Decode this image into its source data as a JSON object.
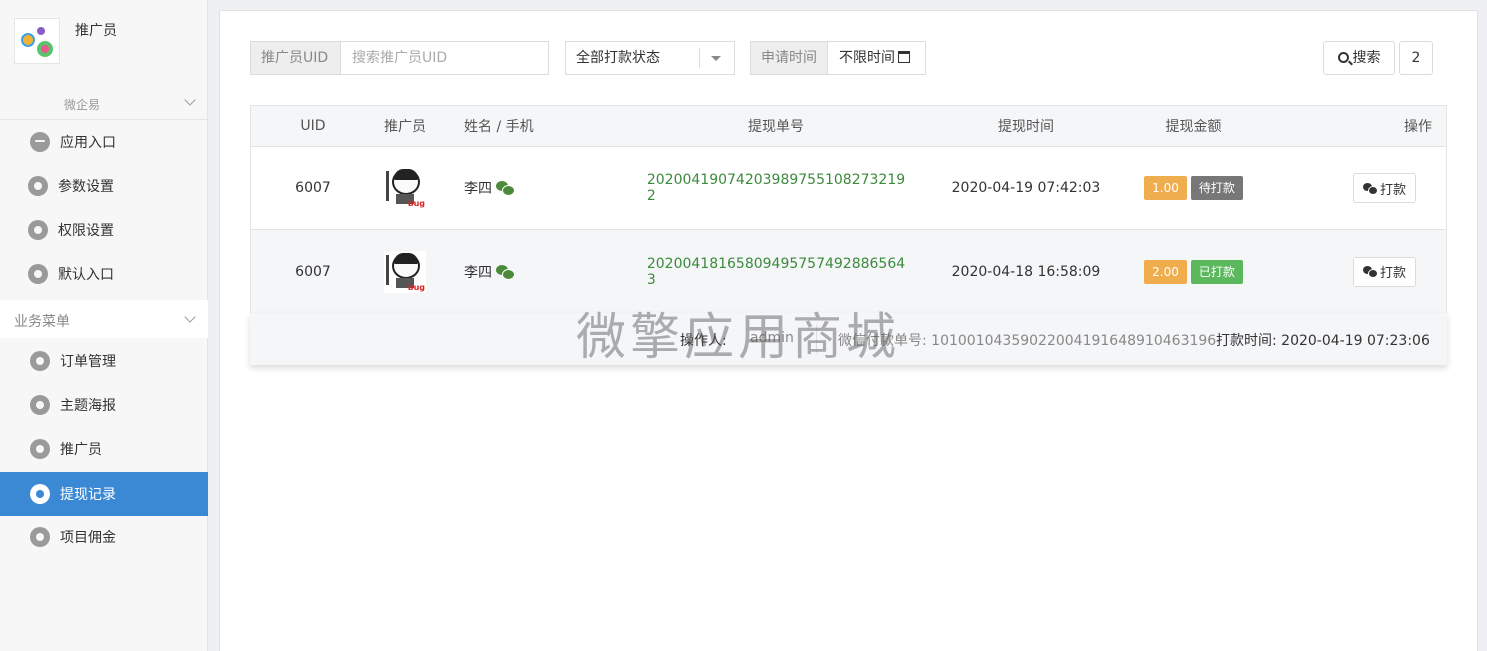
{
  "sidebar": {
    "brand_name": "推广员",
    "wx_group": "微企易",
    "top_items": [
      {
        "label": "应用入口",
        "icon": "chat-bubble-icon"
      },
      {
        "label": "参数设置",
        "icon": "gear-icon"
      },
      {
        "label": "权限设置",
        "icon": "gear-icon"
      },
      {
        "label": "默认入口",
        "icon": "gear-icon"
      }
    ],
    "business_group": "业务菜单",
    "business_items": [
      {
        "label": "订单管理",
        "icon": "gear-icon"
      },
      {
        "label": "主题海报",
        "icon": "gear-icon"
      },
      {
        "label": "推广员",
        "icon": "gear-icon"
      },
      {
        "label": "提现记录",
        "icon": "gear-icon",
        "active": true
      },
      {
        "label": "项目佣金",
        "icon": "gear-icon"
      }
    ],
    "active_color": "#3b89d4"
  },
  "filters": {
    "uid_addon": "推广员UID",
    "uid_placeholder": "搜索推广员UID",
    "status_select": "全部打款状态",
    "time_addon": "申请时间",
    "time_value": "不限时间",
    "search_label": "搜索",
    "count": "2"
  },
  "table": {
    "headers": {
      "uid": "UID",
      "promoter": "推广员",
      "name": "姓名 / 手机",
      "order_no": "提现单号",
      "time": "提现时间",
      "amount": "提现金额",
      "action": "操作"
    },
    "rows": [
      {
        "uid": "6007",
        "name": "李四",
        "order_no": "20200419074203989755108273219​2",
        "time": "2020-04-19 07:42:03",
        "amount": "1.00",
        "status": "待打款",
        "action": "打款"
      },
      {
        "uid": "6007",
        "name": "李四",
        "order_no": "20200418165809495757492886564​3",
        "time": "2020-04-18 16:58:09",
        "amount": "2.00",
        "status": "已打款",
        "action": "打款"
      }
    ]
  },
  "detail": {
    "operator_label": "操作人:",
    "operator_value": "admin",
    "wx_no": "微信付款单号: 1010010435902200419164891046319​6",
    "pay_time": "打款时间: 2020-04-19 07:23:06"
  },
  "watermark": "微擎应用商城",
  "avatar_text": "bug"
}
